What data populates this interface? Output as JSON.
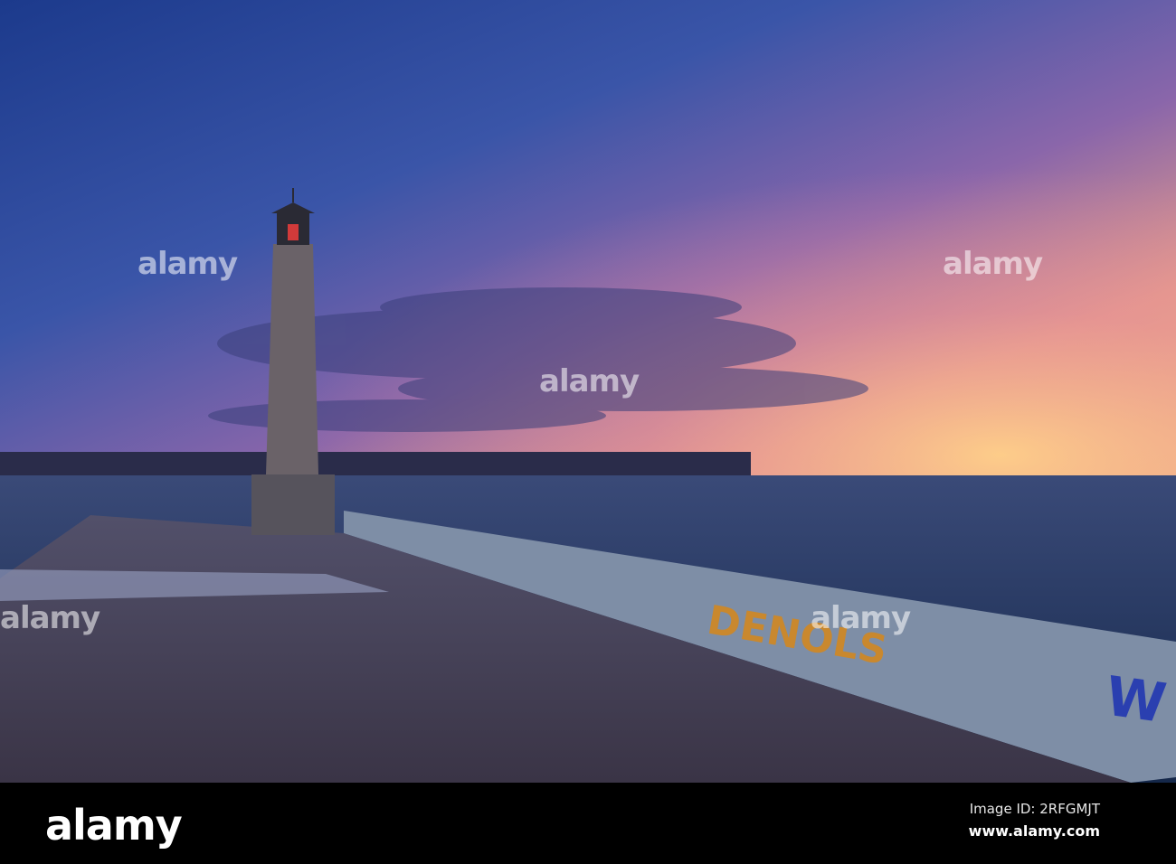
{
  "watermark": {
    "text": "alamy"
  },
  "footer": {
    "logo": "alamy",
    "image_id": "Image ID: 2RFGMJT",
    "website": "www.alamy.com"
  },
  "colors": {
    "sky_top": "#1f3f8f",
    "sky_mid": "#7a5fa8",
    "glow": "#f5a96a",
    "sea": "#1d3558",
    "pier": "#4c4a5e"
  }
}
